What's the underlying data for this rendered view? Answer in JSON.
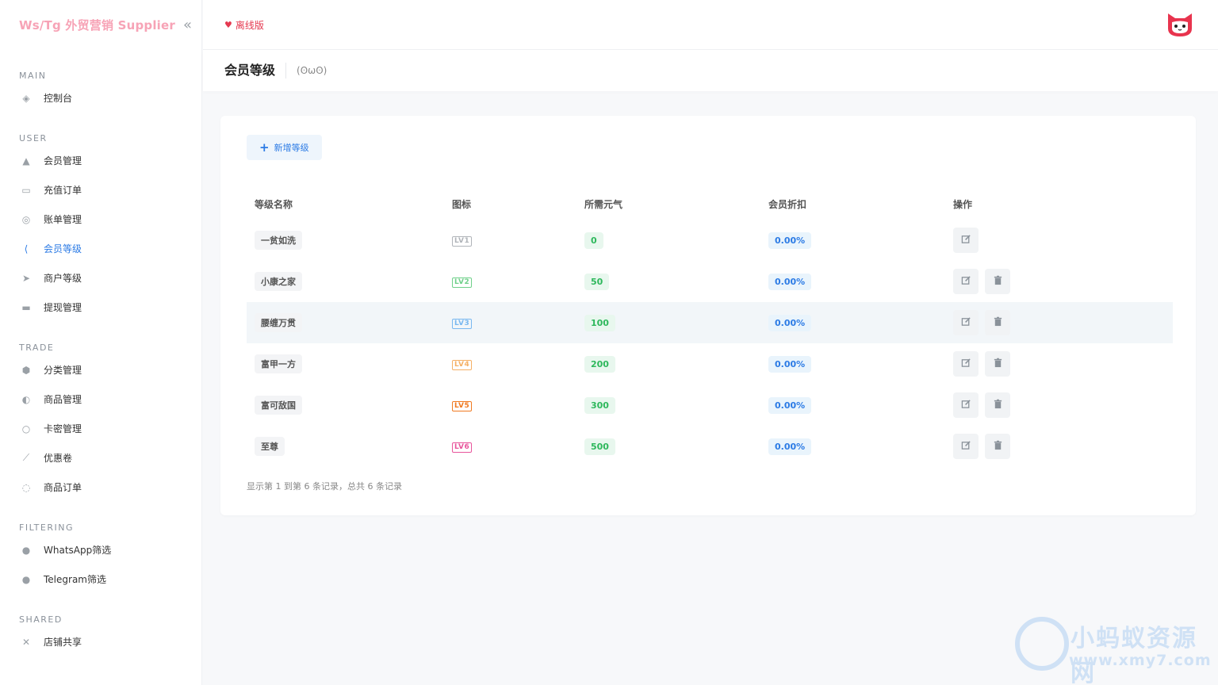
{
  "brand": {
    "title": "Ws/Tg 外贸营销 Supplier",
    "collapse_icon": "«"
  },
  "topbar": {
    "offline_label": "离线版"
  },
  "page": {
    "title": "会员等级",
    "subtitle": "(ʘωʘ)"
  },
  "sidebar": {
    "sections": [
      {
        "title": "MAIN",
        "items": [
          {
            "label": "控制台",
            "icon": "dashboard-icon"
          }
        ]
      },
      {
        "title": "USER",
        "items": [
          {
            "label": "会员管理",
            "icon": "user-icon"
          },
          {
            "label": "充值订单",
            "icon": "recharge-icon"
          },
          {
            "label": "账单管理",
            "icon": "bill-icon"
          },
          {
            "label": "会员等级",
            "icon": "share-icon",
            "active": true
          },
          {
            "label": "商户等级",
            "icon": "rocket-icon"
          },
          {
            "label": "提现管理",
            "icon": "withdraw-icon"
          }
        ]
      },
      {
        "title": "TRADE",
        "items": [
          {
            "label": "分类管理",
            "icon": "category-icon"
          },
          {
            "label": "商品管理",
            "icon": "product-icon"
          },
          {
            "label": "卡密管理",
            "icon": "card-icon"
          },
          {
            "label": "优惠卷",
            "icon": "coupon-icon"
          },
          {
            "label": "商品订单",
            "icon": "order-icon"
          }
        ]
      },
      {
        "title": "FILTERING",
        "items": [
          {
            "label": "WhatsApp筛选",
            "icon": "whatsapp-icon"
          },
          {
            "label": "Telegram筛选",
            "icon": "telegram-icon"
          }
        ]
      },
      {
        "title": "SHARED",
        "items": [
          {
            "label": "店铺共享",
            "icon": "shop-share-icon"
          }
        ]
      }
    ]
  },
  "toolbar": {
    "add_label": "新增等级"
  },
  "table": {
    "headers": [
      "等级名称",
      "图标",
      "所需元气",
      "会员折扣",
      "操作"
    ],
    "rows": [
      {
        "name": "一贫如洗",
        "badge": "LV1",
        "badge_color": "#b0b4b9",
        "required": "0",
        "discount": "0.00%",
        "deletable": false,
        "highlight": false
      },
      {
        "name": "小康之家",
        "badge": "LV2",
        "badge_color": "#6fd08a",
        "required": "50",
        "discount": "0.00%",
        "deletable": true,
        "highlight": false
      },
      {
        "name": "腰缠万贯",
        "badge": "LV3",
        "badge_color": "#79b8f0",
        "required": "100",
        "discount": "0.00%",
        "deletable": true,
        "highlight": true
      },
      {
        "name": "富甲一方",
        "badge": "LV4",
        "badge_color": "#f5b065",
        "required": "200",
        "discount": "0.00%",
        "deletable": true,
        "highlight": false
      },
      {
        "name": "富可敌国",
        "badge": "LV5",
        "badge_color": "#f07a21",
        "required": "300",
        "discount": "0.00%",
        "deletable": true,
        "highlight": false
      },
      {
        "name": "至尊",
        "badge": "LV6",
        "badge_color": "#e8559c",
        "required": "500",
        "discount": "0.00%",
        "deletable": true,
        "highlight": false
      }
    ]
  },
  "footer": {
    "info": "显示第 1 到第 6 条记录，总共 6 条记录"
  },
  "watermark": {
    "text": "小蚂蚁资源网",
    "url": "www.xmy7.com"
  },
  "colors": {
    "accent": "#2c7be5",
    "brand_pink": "#f7a3b6",
    "offline_red": "#e53950",
    "success": "#2eb85c"
  }
}
